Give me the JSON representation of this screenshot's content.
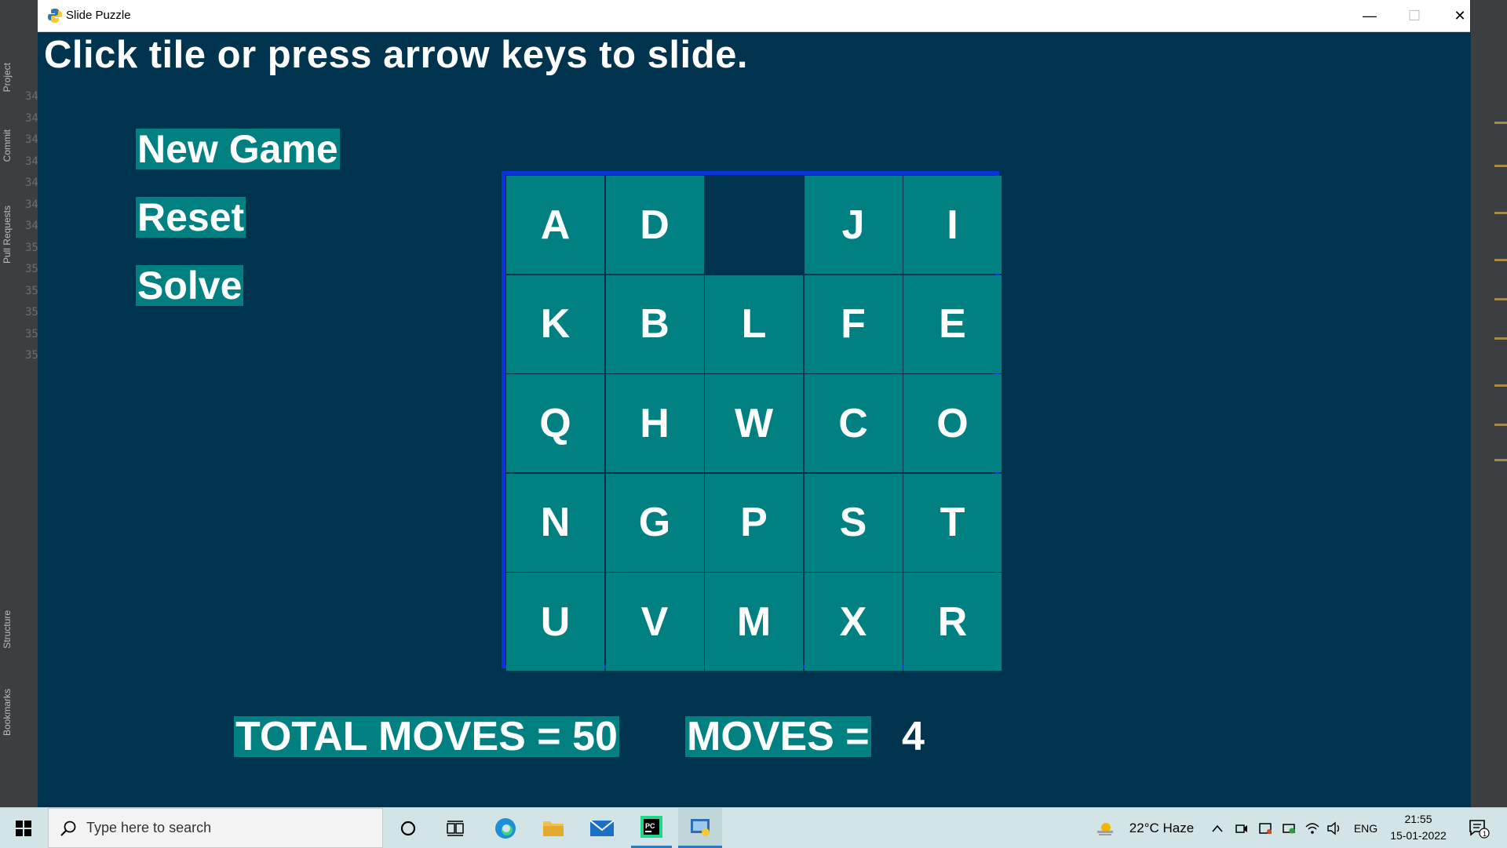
{
  "window": {
    "title": "Slide Puzzle",
    "controls": {
      "minimize": "—",
      "maximize": "☐",
      "close": "✕"
    }
  },
  "ide": {
    "left_tabs": [
      "Project",
      "Commit",
      "Pull Requests",
      "Structure",
      "Bookmarks"
    ],
    "gutter_lines": [
      "34",
      "34",
      "34",
      "34",
      "34",
      "34",
      "34",
      "35",
      "35",
      "35",
      "35",
      "35",
      "35"
    ]
  },
  "game": {
    "instructions": "Click tile or press arrow keys to slide.",
    "buttons": {
      "new_game": "New Game",
      "reset": "Reset",
      "solve": "Solve"
    },
    "grid": [
      [
        "A",
        "D",
        "",
        "J",
        "I"
      ],
      [
        "K",
        "B",
        "L",
        "F",
        "E"
      ],
      [
        "Q",
        "H",
        "W",
        "C",
        "O"
      ],
      [
        "N",
        "G",
        "P",
        "S",
        "T"
      ],
      [
        "U",
        "V",
        "M",
        "X",
        "R"
      ]
    ],
    "total_moves_label": "TOTAL MOVES = 50",
    "moves_label": "MOVES =",
    "moves_value": "4",
    "colors": {
      "background": "#00334d",
      "tile": "#008080",
      "border": "#0a33dd",
      "text": "#ffffff"
    }
  },
  "taskbar": {
    "search_placeholder": "Type here to search",
    "weather": "22°C  Haze",
    "language": "ENG",
    "time": "21:55",
    "date": "15-01-2022",
    "notification_count": "1"
  }
}
